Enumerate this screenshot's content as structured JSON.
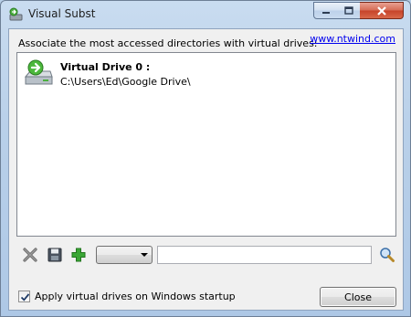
{
  "window": {
    "title": "Visual Subst",
    "minimize_icon": "minimize-icon",
    "maximize_icon": "maximize-icon",
    "close_icon": "close-icon"
  },
  "header": {
    "label": "Associate the most accessed directories with virtual drives:",
    "link": "www.ntwind.com"
  },
  "drives": [
    {
      "name": "Virtual Drive 0 :",
      "path": "C:\\Users\\Ed\\Google Drive\\",
      "icon": "virtual-drive-icon"
    }
  ],
  "toolbar": {
    "delete_icon": "delete-icon",
    "save_icon": "save-icon",
    "add_icon": "add-icon",
    "drive_letter_value": "",
    "path_value": "",
    "browse_icon": "browse-icon"
  },
  "footer": {
    "startup_checkbox_label": "Apply virtual drives on Windows startup",
    "startup_checked": true,
    "close_button_label": "Close"
  },
  "colors": {
    "frame": "#b9d0e9",
    "client_bg": "#f0f0f0",
    "link": "#0000ee",
    "close_button_red": "#c7432a",
    "add_green": "#3aa635"
  }
}
